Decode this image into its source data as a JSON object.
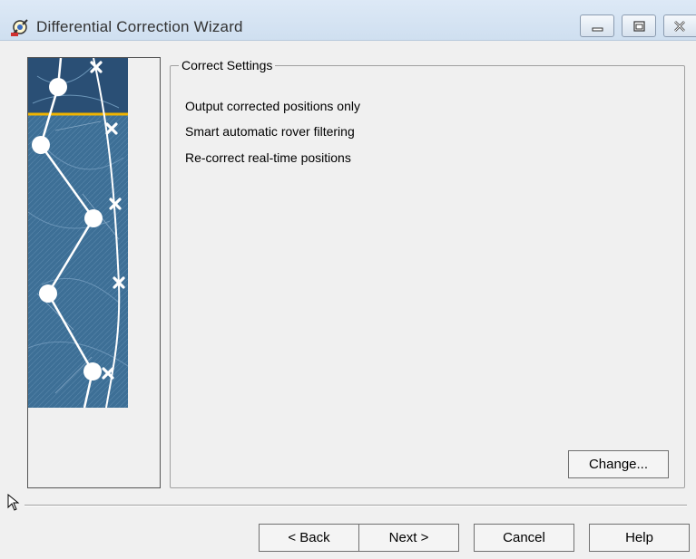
{
  "window": {
    "title": "Differential Correction Wizard",
    "icon": "satellite-dish-icon"
  },
  "group": {
    "legend": "Correct Settings",
    "settings": [
      "Output corrected positions only",
      "Smart automatic rover filtering",
      "Re-correct real-time positions"
    ],
    "change_label": "Change..."
  },
  "buttons": {
    "back": "< Back",
    "next": "Next >",
    "cancel": "Cancel",
    "help": "Help"
  },
  "colors": {
    "map_blue": "#3d6f96",
    "accent_line": "#f0b400"
  }
}
